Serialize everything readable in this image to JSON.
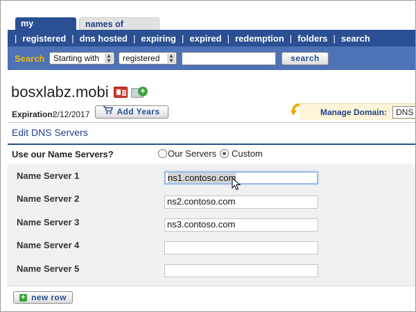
{
  "tabs": [
    {
      "label": "my domains",
      "active": true
    },
    {
      "label": "names of interest",
      "active": false
    }
  ],
  "nav": {
    "items": [
      "registered",
      "dns hosted",
      "expiring",
      "expired",
      "redemption",
      "folders",
      "search"
    ],
    "separator": "|"
  },
  "search": {
    "label": "Search",
    "mode_value": "Starting with",
    "scope_value": "registered",
    "query_value": "",
    "button_label": "search"
  },
  "domain": {
    "name": "bosxlabz.mobi",
    "expiration_label": "Expiration:",
    "expiration_value": "2/12/2017",
    "add_years_label": "Add Years",
    "manage_label": "Manage Domain:",
    "manage_value": "DNS Se"
  },
  "edit_dns": {
    "title": "Edit DNS Servers",
    "use_label": "Use our Name Servers?",
    "option_our": "Our Servers",
    "option_custom": "Custom",
    "selected_option": "Custom",
    "name_servers": [
      {
        "label": "Name Server 1",
        "value": "ns1.contoso.com"
      },
      {
        "label": "Name Server 2",
        "value": "ns2.contoso.com"
      },
      {
        "label": "Name Server 3",
        "value": "ns3.contoso.com"
      },
      {
        "label": "Name Server 4",
        "value": ""
      },
      {
        "label": "Name Server 5",
        "value": ""
      }
    ],
    "new_row_label": "new row"
  },
  "colors": {
    "nav_bg": "#2a4f92",
    "search_bg": "#4d72b5",
    "search_label": "#f5b800",
    "accent_gold": "#f1a900"
  },
  "icons": [
    "id-card-icon",
    "add-folder-icon",
    "cart-icon",
    "arrow-icon",
    "plus-icon",
    "pointer-cursor-icon"
  ]
}
